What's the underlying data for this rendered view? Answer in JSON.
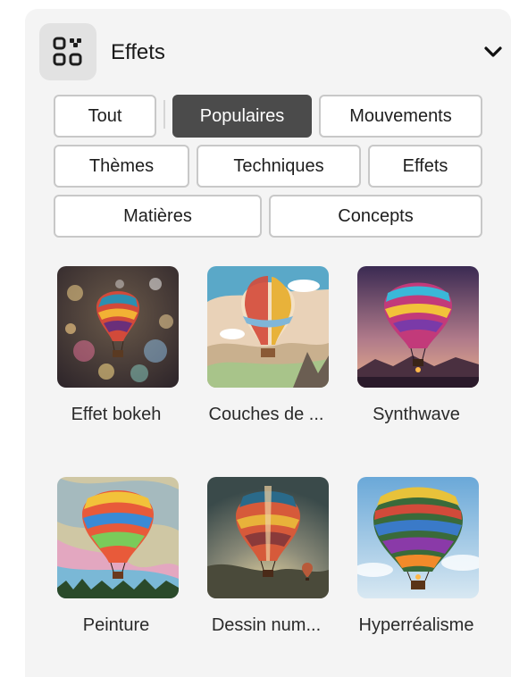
{
  "panel": {
    "title": "Effets",
    "icon": "qr-grid-icon",
    "collapse_icon": "chevron-down-icon"
  },
  "filters": {
    "selected": "Populaires",
    "chips": [
      "Tout",
      "Populaires",
      "Mouvements",
      "Thèmes",
      "Techniques",
      "Effets",
      "Matières",
      "Concepts"
    ]
  },
  "effects": [
    {
      "label": "Effet bokeh",
      "icon": "hot-air-balloon-bokeh-image"
    },
    {
      "label": "Couches de ...",
      "icon": "hot-air-balloon-paper-layers-image"
    },
    {
      "label": "Synthwave",
      "icon": "hot-air-balloon-synthwave-image"
    },
    {
      "label": "Peinture",
      "icon": "hot-air-balloon-painting-image"
    },
    {
      "label": "Dessin num...",
      "icon": "hot-air-balloon-digital-art-image"
    },
    {
      "label": "Hyperréalisme",
      "icon": "hot-air-balloon-hyperrealism-image"
    }
  ],
  "colors": {
    "panel_bg": "#f4f4f4",
    "chip_border": "#c8c8c8",
    "chip_selected_bg": "#4b4b4b"
  }
}
